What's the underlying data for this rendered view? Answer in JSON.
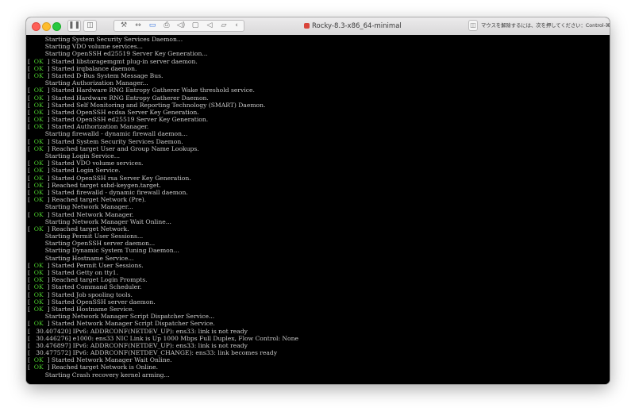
{
  "window": {
    "title": "Rocky-8.3-x86_64-minimal",
    "release_hint": "マウスを解除するには、次を押してください：Control-⌘",
    "title_icon": "vm-icon"
  },
  "toolbar": {
    "buttons": [
      {
        "name": "pause-icon",
        "glyph": "❚❚"
      },
      {
        "name": "snapshot-icon",
        "glyph": "◫"
      }
    ],
    "group": [
      {
        "name": "wrench-icon",
        "glyph": "⚒"
      },
      {
        "name": "arrows-icon",
        "glyph": "↔"
      },
      {
        "name": "harddisk-icon",
        "glyph": "▭",
        "active": true
      },
      {
        "name": "printer-icon",
        "glyph": "⎙"
      },
      {
        "name": "speaker-icon",
        "glyph": "◁)"
      },
      {
        "name": "camera-icon",
        "glyph": "▢"
      },
      {
        "name": "sound-icon",
        "glyph": "◁"
      },
      {
        "name": "folder-icon",
        "glyph": "▱"
      },
      {
        "name": "chevron-left-icon",
        "glyph": "‹"
      }
    ],
    "release_icon": "◫"
  },
  "console": {
    "lines": [
      {
        "status": "",
        "text": "         Starting System Security Services Daemon..."
      },
      {
        "status": "",
        "text": "         Starting VDO volume services..."
      },
      {
        "status": "",
        "text": "         Starting OpenSSH ed25519 Server Key Generation..."
      },
      {
        "status": "OK",
        "text": "Started libstoragemgmt plug-in server daemon."
      },
      {
        "status": "OK",
        "text": "Started irqbalance daemon."
      },
      {
        "status": "OK",
        "text": "Started D-Bus System Message Bus."
      },
      {
        "status": "",
        "text": "         Starting Authorization Manager..."
      },
      {
        "status": "OK",
        "text": "Started Hardware RNG Entropy Gatherer Wake threshold service."
      },
      {
        "status": "OK",
        "text": "Started Hardware RNG Entropy Gatherer Daemon."
      },
      {
        "status": "OK",
        "text": "Started Self Monitoring and Reporting Technology (SMART) Daemon."
      },
      {
        "status": "OK",
        "text": "Started OpenSSH ecdsa Server Key Generation."
      },
      {
        "status": "OK",
        "text": "Started OpenSSH ed25519 Server Key Generation."
      },
      {
        "status": "OK",
        "text": "Started Authorization Manager."
      },
      {
        "status": "",
        "text": "         Starting firewalld - dynamic firewall daemon..."
      },
      {
        "status": "OK",
        "text": "Started System Security Services Daemon."
      },
      {
        "status": "OK",
        "text": "Reached target User and Group Name Lookups."
      },
      {
        "status": "",
        "text": "         Starting Login Service..."
      },
      {
        "status": "OK",
        "text": "Started VDO volume services."
      },
      {
        "status": "OK",
        "text": "Started Login Service."
      },
      {
        "status": "OK",
        "text": "Started OpenSSH rsa Server Key Generation."
      },
      {
        "status": "OK",
        "text": "Reached target sshd-keygen.target."
      },
      {
        "status": "OK",
        "text": "Started firewalld - dynamic firewall daemon."
      },
      {
        "status": "OK",
        "text": "Reached target Network (Pre)."
      },
      {
        "status": "",
        "text": "         Starting Network Manager..."
      },
      {
        "status": "OK",
        "text": "Started Network Manager."
      },
      {
        "status": "",
        "text": "         Starting Network Manager Wait Online..."
      },
      {
        "status": "OK",
        "text": "Reached target Network."
      },
      {
        "status": "",
        "text": "         Starting Permit User Sessions..."
      },
      {
        "status": "",
        "text": "         Starting OpenSSH server daemon..."
      },
      {
        "status": "",
        "text": "         Starting Dynamic System Tuning Daemon..."
      },
      {
        "status": "",
        "text": "         Starting Hostname Service..."
      },
      {
        "status": "OK",
        "text": "Started Permit User Sessions."
      },
      {
        "status": "OK",
        "text": "Started Getty on tty1."
      },
      {
        "status": "OK",
        "text": "Reached target Login Prompts."
      },
      {
        "status": "OK",
        "text": "Started Command Scheduler."
      },
      {
        "status": "OK",
        "text": "Started Job spooling tools."
      },
      {
        "status": "OK",
        "text": "Started OpenSSH server daemon."
      },
      {
        "status": "OK",
        "text": "Started Hostname Service."
      },
      {
        "status": "",
        "text": "         Starting Network Manager Script Dispatcher Service..."
      },
      {
        "status": "OK",
        "text": "Started Network Manager Script Dispatcher Service."
      },
      {
        "status": "",
        "text": "[   30.407420] IPv6: ADDRCONF(NETDEV_UP): ens33: link is not ready"
      },
      {
        "status": "",
        "text": "[   30.446276] e1000: ens33 NIC Link is Up 1000 Mbps Full Duplex, Flow Control: None"
      },
      {
        "status": "",
        "text": "[   30.476897] IPv6: ADDRCONF(NETDEV_UP): ens33: link is not ready"
      },
      {
        "status": "",
        "text": "[   30.477572] IPv6: ADDRCONF(NETDEV_CHANGE): ens33: link becomes ready"
      },
      {
        "status": "OK",
        "text": "Started Network Manager Wait Online."
      },
      {
        "status": "OK",
        "text": "Reached target Network is Online."
      },
      {
        "status": "",
        "text": "         Starting Crash recovery kernel arming..."
      }
    ]
  },
  "colors": {
    "ok": "#4ccf2d",
    "text": "#c9c9c9",
    "background": "#000000"
  }
}
